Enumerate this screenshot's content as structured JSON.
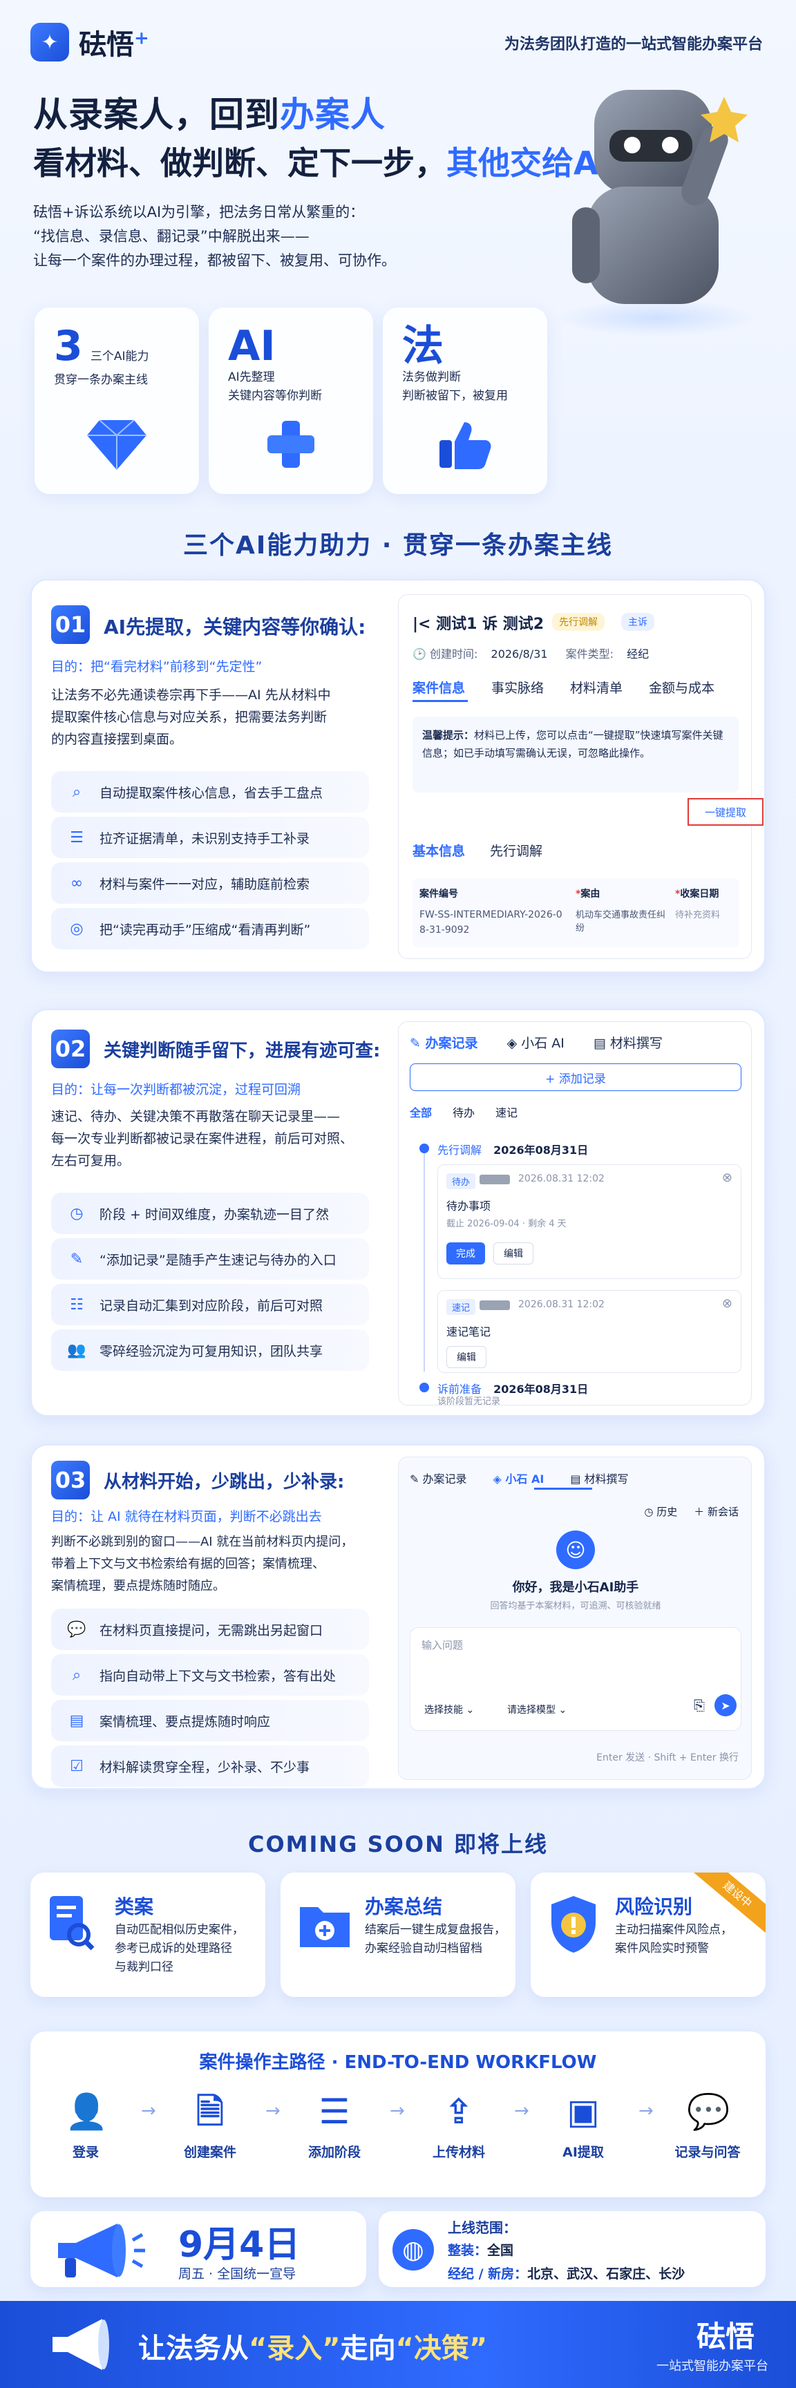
{
  "brand": {
    "name": "砝悟",
    "sup": "+",
    "tagline": "为法务团队打造的一站式智能办案平台"
  },
  "hero": {
    "h1_a": "从录案人，回到",
    "h1_b": "办案人",
    "h2_a": "看材料、做判断、定下一步，",
    "h2_b": "其他交给AI",
    "intro": [
      "砝悟+诉讼系统以AI为引擎，把法务日常从繁重的：",
      "“找信息、录信息、翻记录”中解脱出来——",
      "让每一个案件的办理过程，都被留下、被复用、可协作。"
    ]
  },
  "stats": [
    {
      "big": "3",
      "side": "三个AI能力",
      "sub": "贯穿一条办案主线",
      "icon": "diamond-icon"
    },
    {
      "big": "AI",
      "l1": "AI先整理",
      "l2": "关键内容等你判断",
      "icon": "plus-icon"
    },
    {
      "big": "法",
      "l1": "法务做判断",
      "l2": "判断被留下，被复用",
      "icon": "thumbs-up-icon"
    }
  ],
  "section_title": "三个AI能力助力 · 贯穿一条办案主线",
  "card1": {
    "num": "01",
    "title": "AI先提取，关键内容等你确认:",
    "goal": "目的：把“看完材料”前移到“先定性”",
    "desc": [
      "让法务不必先通读卷宗再下手——AI 先从材料中",
      "提取案件核心信息与对应关系，把需要法务判断",
      "的内容直接摆到桌面。"
    ],
    "features": [
      "自动提取案件核心信息，省去手工盘点",
      "拉齐证据清单，未识别支持手工补录",
      "材料与案件一一对应，辅助庭前检索",
      "把“读完再动手”压缩成“看清再判断”"
    ],
    "panel": {
      "case_title": "测试1 诉 测试2",
      "badge1": "先行调解",
      "badge2": "主诉",
      "created_label": "创建时间:",
      "created": "2026/8/31",
      "type_label": "案件类型:",
      "type": "经纪",
      "tabs": [
        "案件信息",
        "事实脉络",
        "材料清单",
        "金额与成本"
      ],
      "tip_label": "温馨提示：",
      "tip": "材料已上传，您可以点击“一键提取”快速填写案件关键信息；如已手动填写需确认无误，可忽略此操作。",
      "extract_btn": "一键提取",
      "subtabs": [
        "基本信息",
        "先行调解"
      ],
      "fields": [
        {
          "label": "案件编号",
          "value": "FW-SS-INTERMEDIARY-2026-08-31-9092"
        },
        {
          "label": "案由",
          "value": "机动车交通事故责任纠纷"
        },
        {
          "label": "收案日期",
          "value": "待补充资料"
        }
      ]
    }
  },
  "card2": {
    "num": "02",
    "title": "关键判断随手留下，进展有迹可查:",
    "goal": "目的：让每一次判断都被沉淀，过程可回溯",
    "desc": [
      "速记、待办、关键决策不再散落在聊天记录里——",
      "每一次专业判断都被记录在案件进程，前后可对照、",
      "左右可复用。"
    ],
    "features": [
      "阶段 + 时间双维度，办案轨迹一目了然",
      "“添加记录”是随手产生速记与待办的入口",
      "记录自动汇集到对应阶段，前后可对照",
      "零碎经验沉淀为可复用知识，团队共享"
    ],
    "panel": {
      "tabs": [
        "办案记录",
        "小石 AI",
        "材料撰写"
      ],
      "add": "+ 添加记录",
      "filters": [
        "全部",
        "待办",
        "速记"
      ],
      "stage1": "先行调解",
      "stage1_date": "2026年08月31日",
      "todo_tag": "待办",
      "todo_time": "2026.08.31 12:02",
      "todo_title": "待办事项",
      "todo_meta": "截止 2026-09-04 · 剩余 4 天",
      "done_btn": "完成",
      "edit_btn": "编辑",
      "note_tag": "速记",
      "note_time": "2026.08.31 12:02",
      "note_title": "速记笔记",
      "edit_btn2": "编辑",
      "stage2": "诉前准备",
      "stage2_date": "2026年08月31日",
      "stage2_note": "该阶段暂无记录"
    }
  },
  "card3": {
    "num": "03",
    "title": "从材料开始，少跳出，少补录:",
    "goal": "目的：让 AI 就待在材料页面，判断不必跳出去",
    "desc": [
      "判断不必跳到别的窗口——AI 就在当前材料页内提问，",
      "带着上下文与文书检索给有据的回答；案情梳理、",
      "案情梳理，要点提炼随时随应。"
    ],
    "features": [
      "在材料页直接提问，无需跳出另起窗口",
      "指向自动带上下文与文书检索，答有出处",
      "案情梳理、要点提炼随时响应",
      "材料解读贯穿全程，少补录、不少事"
    ],
    "panel": {
      "tabs": [
        "办案记录",
        "小石 AI",
        "材料撰写"
      ],
      "history": "历史",
      "new_chat": "新会话",
      "hello": "你好，我是小石AI助手",
      "hello_sub": "回答均基于本案材料，可追溯、可核验就绪",
      "input_ph": "输入问题",
      "skill": "选择技能",
      "model": "请选择模型",
      "hint": "Enter 发送 · Shift + Enter 换行"
    }
  },
  "soon": {
    "title": "COMING SOON  即将上线",
    "items": [
      {
        "t": "类案",
        "d": [
          "自动匹配相似历史案件，",
          "参考已成诉的处理路径",
          "与裁判口径"
        ],
        "icon": "document-search-icon"
      },
      {
        "t": "办案总结",
        "d": [
          "结案后一键生成复盘报告，",
          "办案经验自动归档留档"
        ],
        "icon": "folder-add-icon"
      },
      {
        "t": "风险识别",
        "d": [
          "主动扫描案件风险点，",
          "案件风险实时预警"
        ],
        "icon": "shield-alert-icon",
        "ribbon": "建设中"
      }
    ]
  },
  "workflow": {
    "title": "案件操作主路径 · END-TO-END WORKFLOW",
    "steps": [
      "登录",
      "创建案件",
      "添加阶段",
      "上传材料",
      "AI提取",
      "记录与问答"
    ]
  },
  "launch": {
    "date": "9月4日",
    "sub": "周五 · 全国统一宣导",
    "scope_title": "上线范围：",
    "scope1_label": "整装：",
    "scope1": "全国",
    "scope2_label": "经纪 / 新房：",
    "scope2": "北京、武汉、石家庄、长沙"
  },
  "footer": {
    "slogan_a": "让法务从",
    "q1": "“录入”",
    "mid": "走向",
    "q2": "“决策”",
    "brand": "砝悟",
    "brand_sub": "一站式智能办案平台"
  },
  "colors": {
    "accent": "#2f6bff",
    "deep": "#1b4ed8",
    "red": "#e23b3b",
    "green": "#2bb673"
  }
}
